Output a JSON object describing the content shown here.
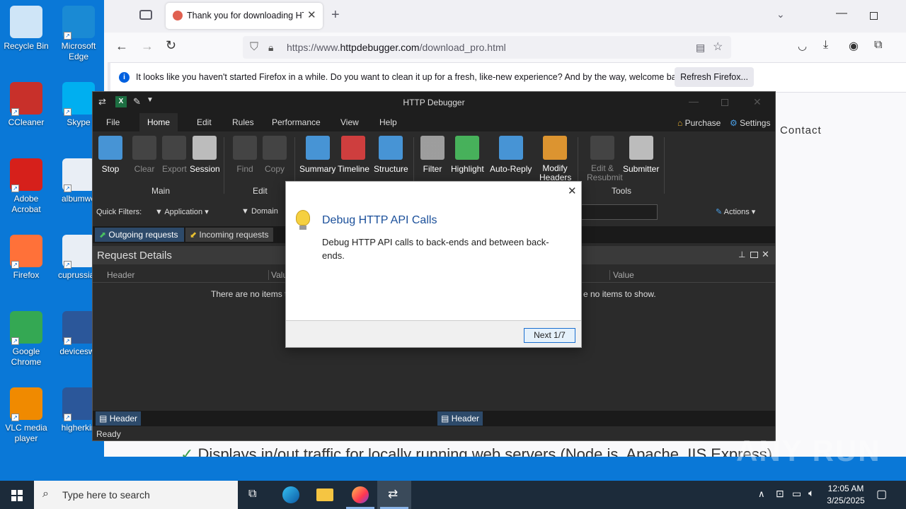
{
  "desktop": {
    "icons": [
      {
        "label": "Recycle Bin",
        "color": "#cfe5f7"
      },
      {
        "label": "Microsoft Edge",
        "color": "#1a8ad4"
      },
      {
        "label": "CCleaner",
        "color": "#c8302a"
      },
      {
        "label": "Skype",
        "color": "#00aff0"
      },
      {
        "label": "Adobe Acrobat",
        "color": "#d6201b"
      },
      {
        "label": "albumwe",
        "color": "#e9eef5"
      },
      {
        "label": "Firefox",
        "color": "#ff7139"
      },
      {
        "label": "cuprussian",
        "color": "#e9eef5"
      },
      {
        "label": "Google Chrome",
        "color": "#34a853"
      },
      {
        "label": "deviceswr",
        "color": "#2b579a"
      },
      {
        "label": "VLC media player",
        "color": "#f08a00"
      },
      {
        "label": "higherkin",
        "color": "#2b579a"
      }
    ]
  },
  "browser": {
    "tab_title": "Thank you for downloading HT",
    "url_host": "https://www.",
    "url_domain": "httpdebugger.com",
    "url_path": "/download_pro.html",
    "notification": "It looks like you haven't started Firefox in a while. Do you want to clean it up for a fresh, like-new experience? And by the way, welcome back!",
    "refresh_button": "Refresh Firefox...",
    "page_contact": "Contact",
    "page_text": "Displays in/out traffic for locally running web servers (Node.js, Apache, IIS Express)"
  },
  "app": {
    "title": "HTTP Debugger",
    "menu": [
      "File",
      "Home",
      "Edit",
      "Rules",
      "Performance",
      "View",
      "Help"
    ],
    "purchase": "Purchase",
    "settings": "Settings",
    "ribbon": {
      "main": [
        "Stop",
        "Clear",
        "Export",
        "Session"
      ],
      "edit": [
        "Find",
        "Copy"
      ],
      "view": [
        "Summary",
        "Timeline",
        "Structure"
      ],
      "rules": [
        "Filter",
        "Highlight",
        "Auto-Reply",
        "Modify Headers"
      ],
      "tools": [
        "Edit & Resubmit",
        "Submitter"
      ],
      "group_main": "Main",
      "group_edit": "Edit",
      "group_tools": "Tools"
    },
    "quick_filters_label": "Quick Filters:",
    "qf_application": "Application",
    "qf_domain": "Domain",
    "actions": "Actions",
    "tab_outgoing": "Outgoing requests",
    "tab_incoming": "Incoming requests",
    "panel_title": "Request Details",
    "col_header": "Header",
    "col_value": "Value",
    "col_value_short": "Valu",
    "empty_left": "There are no items t",
    "empty_right": "e no items to show.",
    "bottom_tab": "Header",
    "status": "Ready"
  },
  "dialog": {
    "title": "Debug HTTP API Calls",
    "body": "Debug HTTP API calls to back-ends and between back-ends.",
    "next": "Next 1/7"
  },
  "taskbar": {
    "search_placeholder": "Type here to search",
    "time": "12:05 AM",
    "date": "3/25/2025"
  },
  "watermark": "ANY RUN"
}
